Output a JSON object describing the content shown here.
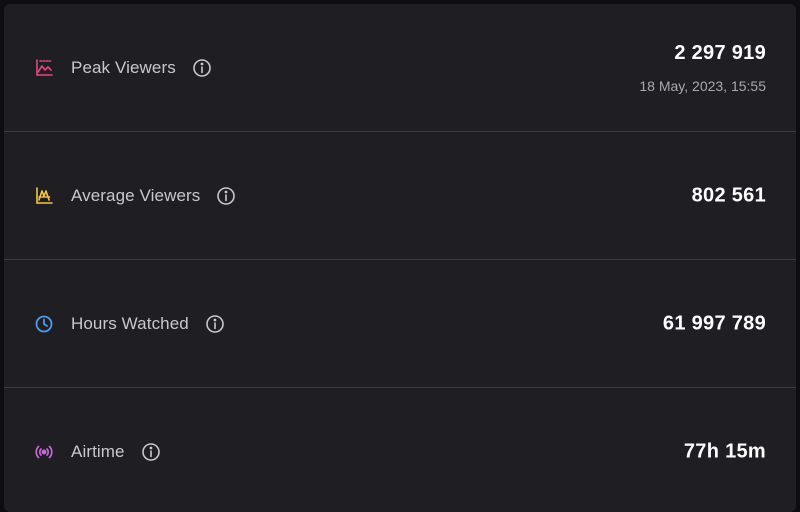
{
  "colors": {
    "peak_icon": "#e8467c",
    "average_icon": "#f5c542",
    "hours_icon": "#4a9bef",
    "airtime_icon": "#c766dd",
    "info_icon": "#c8c8cc"
  },
  "metrics": [
    {
      "icon": "chart-line-icon",
      "label": "Peak Viewers",
      "value": "2 297 919",
      "sub": "18 May, 2023, 15:55"
    },
    {
      "icon": "chart-average-icon",
      "label": "Average Viewers",
      "value": "802 561"
    },
    {
      "icon": "clock-icon",
      "label": "Hours Watched",
      "value": "61 997 789"
    },
    {
      "icon": "broadcast-icon",
      "label": "Airtime",
      "value": "77h 15m"
    }
  ]
}
